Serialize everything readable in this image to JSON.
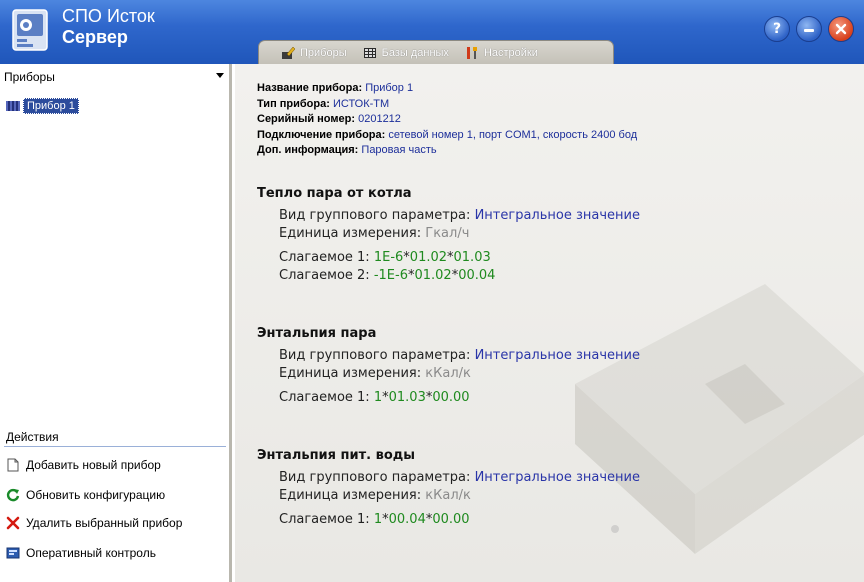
{
  "app": {
    "title_line1": "СПО Исток",
    "title_line2": "Сервер"
  },
  "tabs": [
    {
      "label": "Приборы",
      "icon": "pencil-device-icon"
    },
    {
      "label": "Базы данных",
      "icon": "database-grid-icon"
    },
    {
      "label": "Настройки",
      "icon": "tools-icon"
    }
  ],
  "window_buttons": {
    "help": "?",
    "minimize": "minimize-icon",
    "close": "close-icon"
  },
  "left": {
    "devices_header": "Приборы",
    "devices": [
      {
        "label": "Прибор 1"
      }
    ],
    "actions_title": "Действия",
    "actions": [
      {
        "label": "Добавить новый прибор",
        "icon": "new-document-icon"
      },
      {
        "label": "Обновить конфигурацию",
        "icon": "refresh-icon"
      },
      {
        "label": "Удалить выбранный прибор",
        "icon": "delete-x-icon"
      },
      {
        "label": "Оперативный контроль",
        "icon": "monitor-icon"
      }
    ]
  },
  "info": {
    "name_key": "Название прибора:",
    "name_val": "Прибор 1",
    "type_key": "Тип прибора:",
    "type_val": "ИСТОК-ТМ",
    "serial_key": "Серийный номер:",
    "serial_val": "0201212",
    "conn_key": "Подключение прибора:",
    "conn_val": "сетевой номер 1, порт COM1, скорость 2400 бод",
    "extra_key": "Доп. информация:",
    "extra_val": "Паровая часть"
  },
  "sections": [
    {
      "title": "Тепло пара от котла",
      "type_key": "Вид группового параметра:",
      "type_val": "Интегральное значение",
      "unit_key": "Единица измерения:",
      "unit_val": "Гкал/ч",
      "terms": [
        {
          "key": "Слагаемое 1:",
          "parts": [
            "1E-6",
            "01.02",
            "01.03"
          ]
        },
        {
          "key": "Слагаемое 2:",
          "parts": [
            "-1E-6",
            "01.02",
            "00.04"
          ]
        }
      ]
    },
    {
      "title": "Энтальпия пара",
      "type_key": "Вид группового параметра:",
      "type_val": "Интегральное значение",
      "unit_key": "Единица измерения:",
      "unit_val": "кКал/к",
      "terms": [
        {
          "key": "Слагаемое 1:",
          "parts": [
            "1",
            "01.03",
            "00.00"
          ]
        }
      ]
    },
    {
      "title": "Энтальпия пит. воды",
      "type_key": "Вид группового параметра:",
      "type_val": "Интегральное значение",
      "unit_key": "Единица измерения:",
      "unit_val": "кКал/к",
      "terms": [
        {
          "key": "Слагаемое 1:",
          "parts": [
            "1",
            "00.04",
            "00.00"
          ]
        }
      ]
    }
  ],
  "term_separator": "*",
  "colors": {
    "titlebar": "#2f67cc",
    "value_blue": "#1d2f9a",
    "term_green": "#1f8a1f",
    "unit_gray": "#8a8a8a"
  }
}
